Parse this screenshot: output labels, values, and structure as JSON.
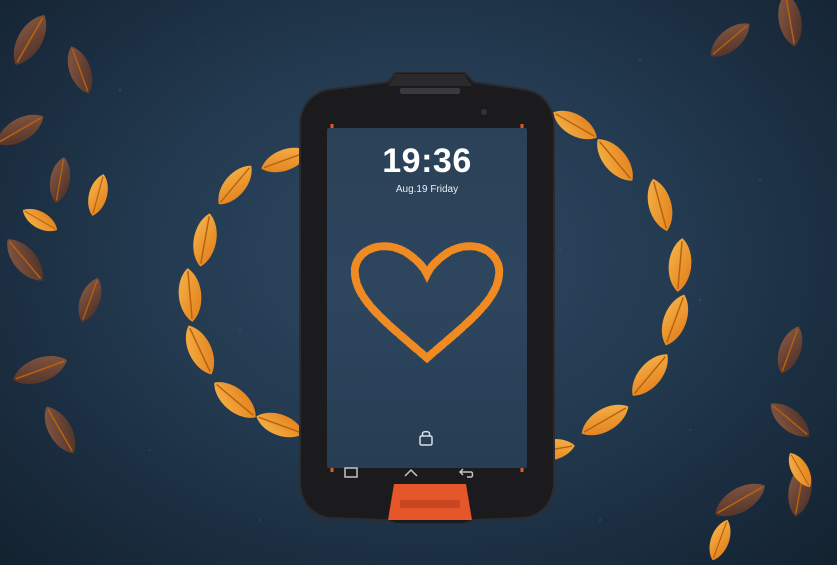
{
  "lockscreen": {
    "time": "19:36",
    "date": "Aug.19 Friday"
  },
  "icons": {
    "lock": "lock-icon",
    "recent": "recent-apps-icon",
    "home": "home-icon",
    "back": "back-icon"
  },
  "colors": {
    "background": "#233a50",
    "leaf": "#f29a2e",
    "phone_body": "#1b1b1d",
    "accent": "#e5562a"
  }
}
